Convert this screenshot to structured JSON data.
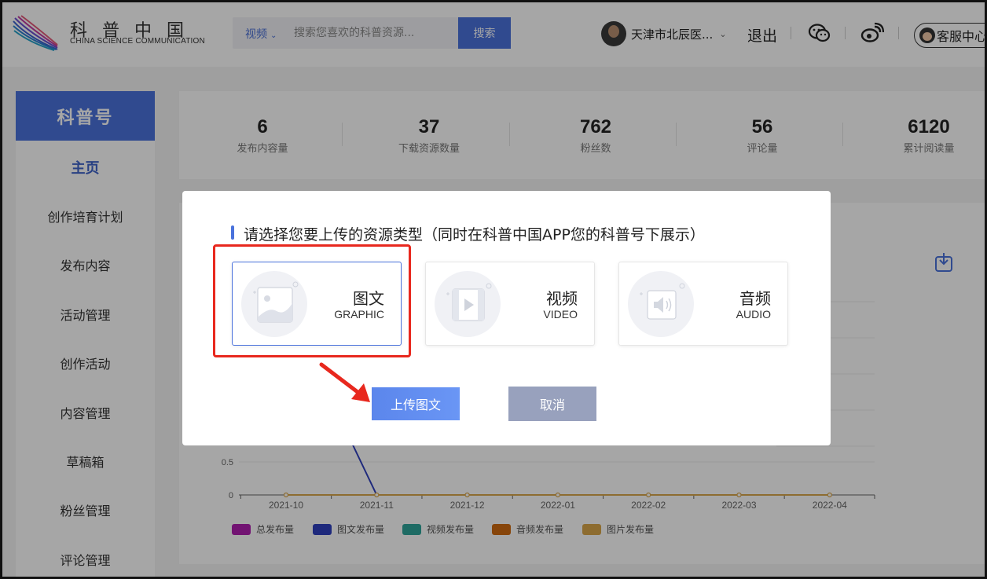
{
  "header": {
    "logo_cn": "科普中国",
    "logo_en": "CHINA SCIENCE COMMUNICATION",
    "search_type": "视频",
    "search_placeholder": "搜索您喜欢的科普资源...",
    "search_button": "搜索",
    "user_name": "天津市北辰医...",
    "logout": "退出",
    "service": "客服中心"
  },
  "sidebar": {
    "title": "科普号",
    "items": [
      {
        "label": "主页",
        "active": true
      },
      {
        "label": "创作培育计划"
      },
      {
        "label": "发布内容"
      },
      {
        "label": "活动管理"
      },
      {
        "label": "创作活动"
      },
      {
        "label": "内容管理"
      },
      {
        "label": "草稿箱"
      },
      {
        "label": "粉丝管理"
      },
      {
        "label": "评论管理"
      }
    ]
  },
  "stats": [
    {
      "value": "6",
      "label": "发布内容量"
    },
    {
      "value": "37",
      "label": "下载资源数量"
    },
    {
      "value": "762",
      "label": "粉丝数"
    },
    {
      "value": "56",
      "label": "评论量"
    },
    {
      "value": "6120",
      "label": "累计阅读量"
    }
  ],
  "chart_data": {
    "type": "line",
    "x": [
      "2021-10",
      "2021-11",
      "2021-12",
      "2022-01",
      "2022-02",
      "2022-03",
      "2022-04"
    ],
    "ylim": [
      0,
      1
    ],
    "yticks_visible": [
      "0",
      "0.5"
    ],
    "series": [
      {
        "name": "总发布量",
        "color": "#b01eb0",
        "values": [
          null,
          0,
          0,
          0,
          0,
          0,
          0
        ]
      },
      {
        "name": "图文发布量",
        "color": "#2f3fbf",
        "values": [
          null,
          0,
          0,
          0,
          0,
          0,
          0
        ]
      },
      {
        "name": "视频发布量",
        "color": "#2ea59a",
        "values": [
          0,
          0,
          0,
          0,
          0,
          0,
          0
        ]
      },
      {
        "name": "音频发布量",
        "color": "#d06a10",
        "values": [
          0,
          0,
          0,
          0,
          0,
          0,
          0
        ]
      },
      {
        "name": "图片发布量",
        "color": "#d9a64a",
        "values": [
          0,
          0,
          0,
          0,
          0,
          0,
          0
        ]
      }
    ],
    "legend": "bottom"
  },
  "modal": {
    "title": "请选择您要上传的资源类型（同时在科普中国APP您的科普号下展示）",
    "types": [
      {
        "cn": "图文",
        "en": "GRAPHIC",
        "icon": "image-icon",
        "selected": true
      },
      {
        "cn": "视频",
        "en": "VIDEO",
        "icon": "video-icon"
      },
      {
        "cn": "音频",
        "en": "AUDIO",
        "icon": "audio-icon"
      }
    ],
    "confirm": "上传图文",
    "cancel": "取消"
  },
  "colors": {
    "accent": "#4a72dc",
    "highlight": "#e8281e"
  }
}
